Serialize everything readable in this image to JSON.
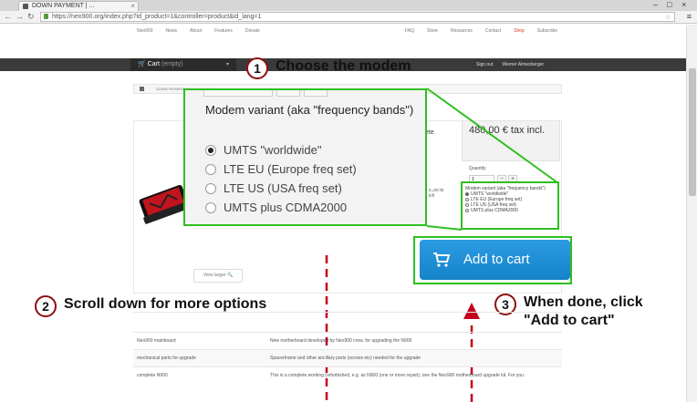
{
  "browser": {
    "tab_title": "DOWN PAYMENT | ...",
    "tab_close": "×",
    "win_controls": [
      "–",
      "□",
      "×"
    ],
    "nav": [
      "←",
      "→",
      "↻"
    ],
    "url": "https://neo900.org/index.php?id_product=1&controller=product&id_lang=1",
    "star": "☆",
    "menu": "≡"
  },
  "site_nav": {
    "left": [
      "Neo900",
      "News",
      "About",
      "Features",
      "Donate"
    ],
    "right": [
      "FAQ",
      "Store",
      "Resources",
      "Contact",
      "Shop",
      "Subscribe"
    ]
  },
  "header": {
    "cart_label": "Cart",
    "cart_state": "(empty)",
    "caret": "▾",
    "signout": "Sign out",
    "user": "Werner Almesberger"
  },
  "breadcrumb": "DOWN PAYMENT (1st payment) > ...",
  "product": {
    "view_larger": "View larger 🔍",
    "desc_fragment": "ete",
    "ship_fragment": "s.,oo to ich",
    "price": "480,00 € tax incl.",
    "quantity_label": "Quantity",
    "quantity_value": "1",
    "minus": "−",
    "plus": "+"
  },
  "small_variant": {
    "title": "Modem variant (aka \"frequency bands\")",
    "options": [
      "UMTS \"worldwide\"",
      "LTE EU (Europe freq set)",
      "LTE US (USA freq set)",
      "UMTS plus CDMA2000"
    ],
    "selected": 0
  },
  "callout": {
    "title": "Modem variant (aka \"frequency bands\")",
    "options": [
      "UMTS \"worldwide\"",
      "LTE EU (Europe freq set)",
      "LTE US (USA freq set)",
      "UMTS plus CDMA2000"
    ],
    "selected": 0
  },
  "add_to_cart": "Add to cart",
  "annotations": {
    "step1_num": "1",
    "step1_text": "Choose the modem",
    "step2_num": "2",
    "step2_text": "Scroll down for more options",
    "step3_num": "3",
    "step3_text": "When done, click \"Add to cart\""
  },
  "table": [
    {
      "name": "Neo900 mainboard",
      "desc": "New motherboard developed by Neo900 crew, for upgrading the N900"
    },
    {
      "name": "mechanical parts for upgrade",
      "desc": "Spacerframe and other ancillary parts (screws etc) needed for the upgrade"
    },
    {
      "name": "complete N900",
      "desc": "This is a complete working (refurbished, e.g. as N900 (one or more repair), one the Neo900 motherboard upgrade kit. For you"
    }
  ],
  "colors": {
    "highlight": "#2fbf1f",
    "annotation_red": "#c4001c",
    "button_blue": "#1a8fd6"
  }
}
